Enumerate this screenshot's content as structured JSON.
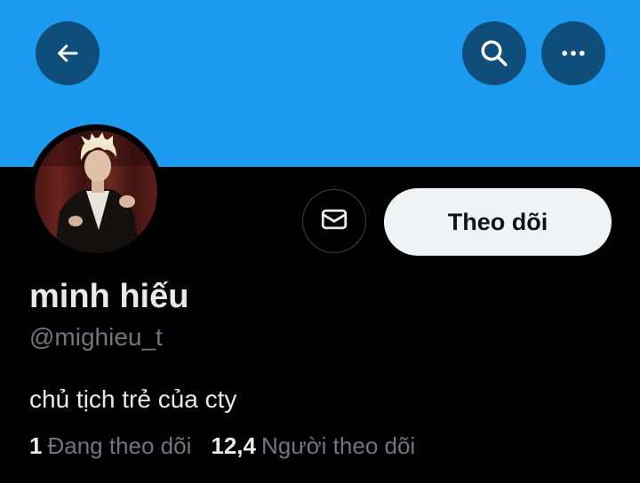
{
  "header": {
    "back_icon": "arrow-left-icon",
    "search_icon": "search-icon",
    "more_icon": "more-horizontal-icon"
  },
  "profile": {
    "display_name": "minh hiếu",
    "handle": "@mighieu_t",
    "bio": "chủ tịch trẻ của cty",
    "avatar": "profile-photo"
  },
  "actions": {
    "message_icon": "envelope-icon",
    "follow_label": "Theo dõi"
  },
  "stats": {
    "following_count": "1",
    "following_label": "Đang theo dõi",
    "followers_count": "12,4",
    "followers_label": "Người theo dõi"
  },
  "colors": {
    "banner": "#1d9bf0",
    "header_button": "#0f4e7a",
    "background": "#000000",
    "primary_text": "#e7e9ea",
    "secondary_text": "#71767b",
    "follow_button_bg": "#eff3f4"
  }
}
